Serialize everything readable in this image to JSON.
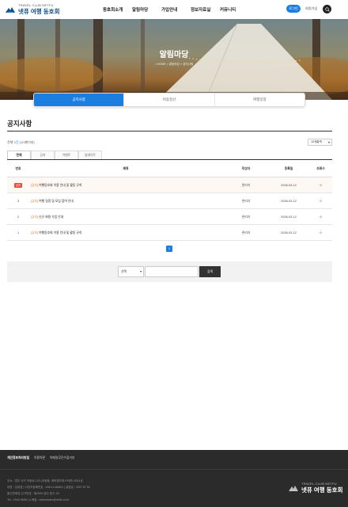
{
  "header": {
    "logo_small": "TRAVEL CLUB NETFU",
    "logo_big": "넷퓨 여행 동호회",
    "nav": [
      "동호회소개",
      "알림마당",
      "가입안내",
      "정보자료실",
      "커뮤니티"
    ],
    "login": "로그인",
    "join": "회원가입"
  },
  "hero": {
    "title": "알림마당",
    "breadcrumb": "⌂ HOME  >  알림마당  >  공지사항"
  },
  "subtabs": [
    {
      "label": "공지사항",
      "active": true
    },
    {
      "label": "비용정산",
      "active": false
    },
    {
      "label": "여행일정",
      "active": false
    }
  ],
  "board": {
    "title": "공지사항",
    "total_prefix": "전체 ",
    "total_count": "3건",
    "total_suffix": " (1/1페이지)",
    "per_page": "10개출력",
    "categories": [
      {
        "label": "전체",
        "active": true
      },
      {
        "label": "공지",
        "active": false
      },
      {
        "label": "이벤트",
        "active": false
      },
      {
        "label": "업데이트",
        "active": false
      }
    ],
    "columns": {
      "no": "번호",
      "title": "제목",
      "author": "작성자",
      "date": "등록일",
      "views": "조회수"
    },
    "rows": [
      {
        "no": "공지",
        "category": "[공지]",
        "title": "여행동호회 이용 안내 및 활동 규칙",
        "author": "관리자",
        "date": "2026-03-12",
        "views": "0",
        "notice": true
      },
      {
        "no": "3",
        "category": "[공지]",
        "title": "여행 일정 및 모임 참여 안내",
        "author": "관리자",
        "date": "2026-03-12",
        "views": "0",
        "notice": false
      },
      {
        "no": "2",
        "category": "[공지]",
        "title": "신규 회원 가입 안내",
        "author": "관리자",
        "date": "2026-03-12",
        "views": "0",
        "notice": false
      },
      {
        "no": "1",
        "category": "[공지]",
        "title": "여행동호회 이용 안내 및 활동 규칙",
        "author": "관리자",
        "date": "2026-03-12",
        "views": "0",
        "notice": false
      }
    ],
    "page": "1"
  },
  "search": {
    "select": "선택",
    "button": "검색"
  },
  "footer": {
    "links": [
      "개인정보처리방침",
      "이용약관",
      "이메일무단수집거부"
    ],
    "info": [
      "주소 : 경주 서구 지중로 124 (지중동, 에이원오피스타운) 5001호",
      "대표 : 김대표 | 사업자등록번호 : 408-14-66501 | 설립일 : 2007.07.02",
      "통신판매업 신고번호 : 제2000-경주 동구-43",
      "Tel : 1544-9638 | e-메일 : webmaster@netfu.co.kr"
    ],
    "logo_small": "TRAVEL CLUB NETFU",
    "logo_big": "넷퓨 여행 동호회"
  },
  "colors": {
    "accent": "#1c7fe0",
    "notice_badge": "#e34b3b",
    "category": "#e08030",
    "footer_bg": "#2b2b2b"
  }
}
